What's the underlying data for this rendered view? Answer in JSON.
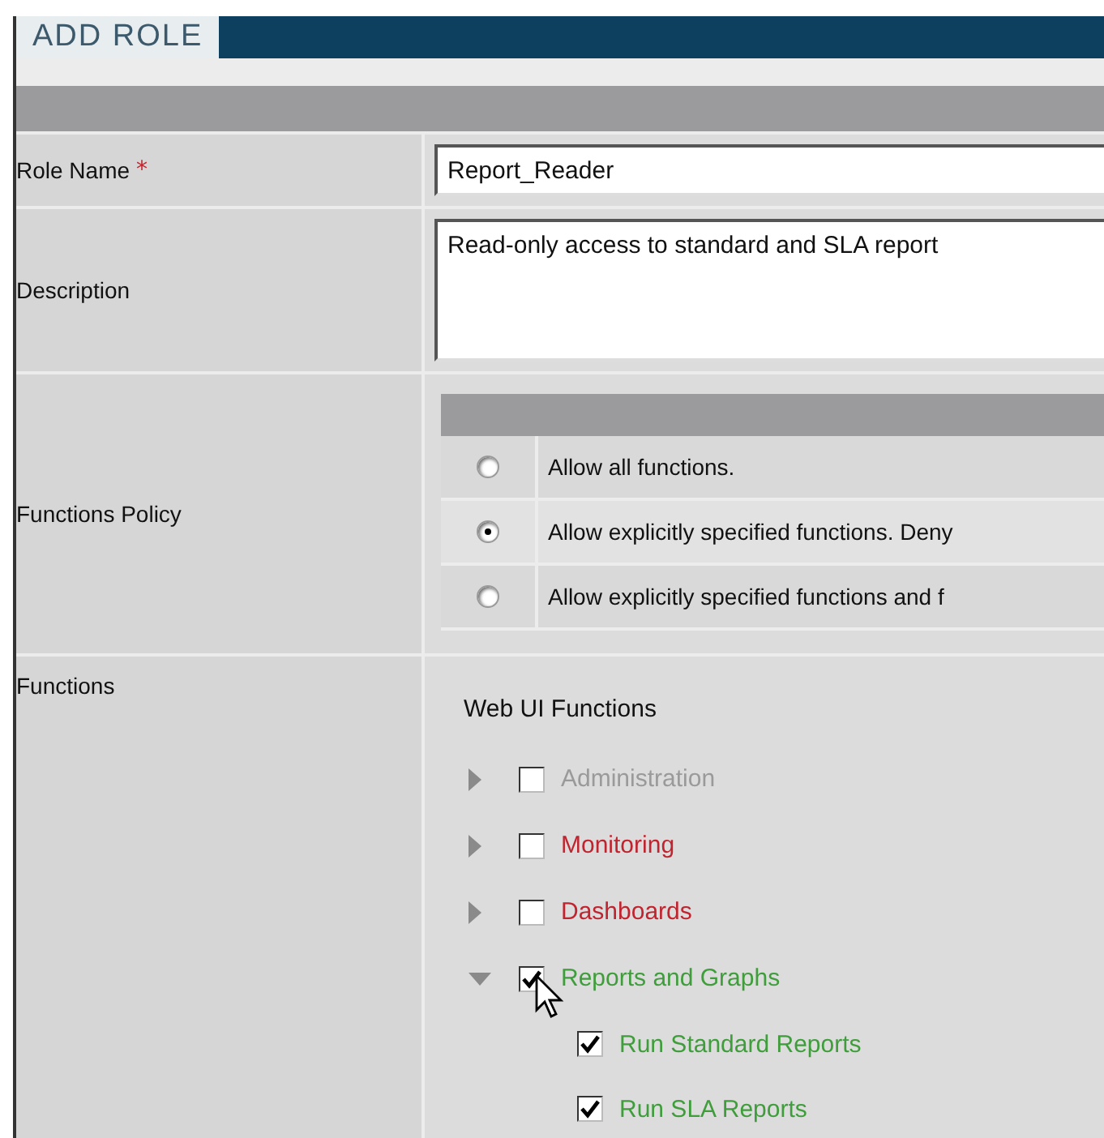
{
  "header": {
    "title": "ADD ROLE"
  },
  "form": {
    "role_name": {
      "label": "Role Name",
      "required_mark": "*",
      "value": "Report_Reader"
    },
    "description": {
      "label": "Description",
      "value": "Read-only access to standard and SLA report"
    },
    "functions_policy": {
      "label": "Functions Policy",
      "options": [
        {
          "label": "Allow all functions.",
          "selected": false
        },
        {
          "label": "Allow explicitly specified functions. Deny",
          "selected": true
        },
        {
          "label": "Allow explicitly specified functions and f",
          "selected": false
        }
      ]
    },
    "functions": {
      "label": "Functions",
      "group_title": "Web UI Functions",
      "items": [
        {
          "label": "Administration",
          "color": "#9a9a9a",
          "checked": false,
          "expanded": false
        },
        {
          "label": "Monitoring",
          "color": "#c0242f",
          "checked": false,
          "expanded": false
        },
        {
          "label": "Dashboards",
          "color": "#c0242f",
          "checked": false,
          "expanded": false
        },
        {
          "label": "Reports and Graphs",
          "color": "#3f9d3c",
          "checked": true,
          "expanded": true,
          "children": [
            {
              "label": "Run Standard Reports",
              "color": "#3f9d3c",
              "checked": true
            },
            {
              "label": "Run SLA Reports",
              "color": "#3f9d3c",
              "checked": true
            }
          ]
        }
      ]
    }
  }
}
